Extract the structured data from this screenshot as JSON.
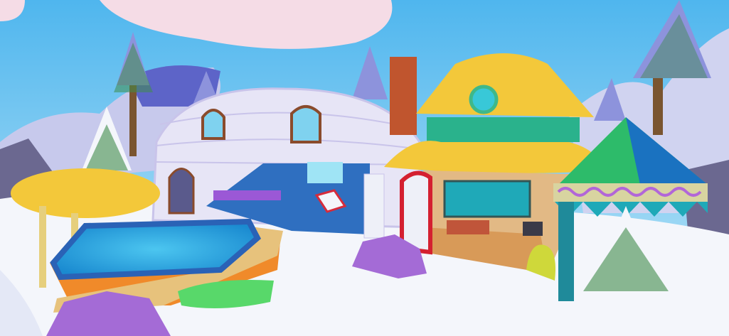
{
  "scene": {
    "description_free": true,
    "colors": {
      "sky_top": "#4fb6ee",
      "sky_bottom": "#bfe6f7",
      "cloud": "#f5dce6",
      "snow": "#f4f6fb",
      "mountain": "#c7c9ec",
      "rock": "#6b6890",
      "pine_snow": "#8d93dc",
      "pine_green": "#3f8c4b",
      "trunk": "#7a5530",
      "igloo": "#e7e5f6",
      "igloo_brick_line": "#c9c4ea",
      "floor_blue": "#2f6fc0",
      "roof_yellow": "#f3c83a",
      "window_teal": "#38c8d8",
      "chimney": "#c0552e",
      "wood_floor": "#d89a58",
      "pool_water": "#29a4e0",
      "pool_rim": "#2a62b6",
      "deck": "#e7c27c",
      "tent_green": "#2dbb6a",
      "tent_blue": "#1a72c0",
      "tent_band": "#d8d4a0",
      "tent_pattern": "#b266d8",
      "purple_rock": "#a46bd6",
      "moss": "#58d86a"
    }
  }
}
